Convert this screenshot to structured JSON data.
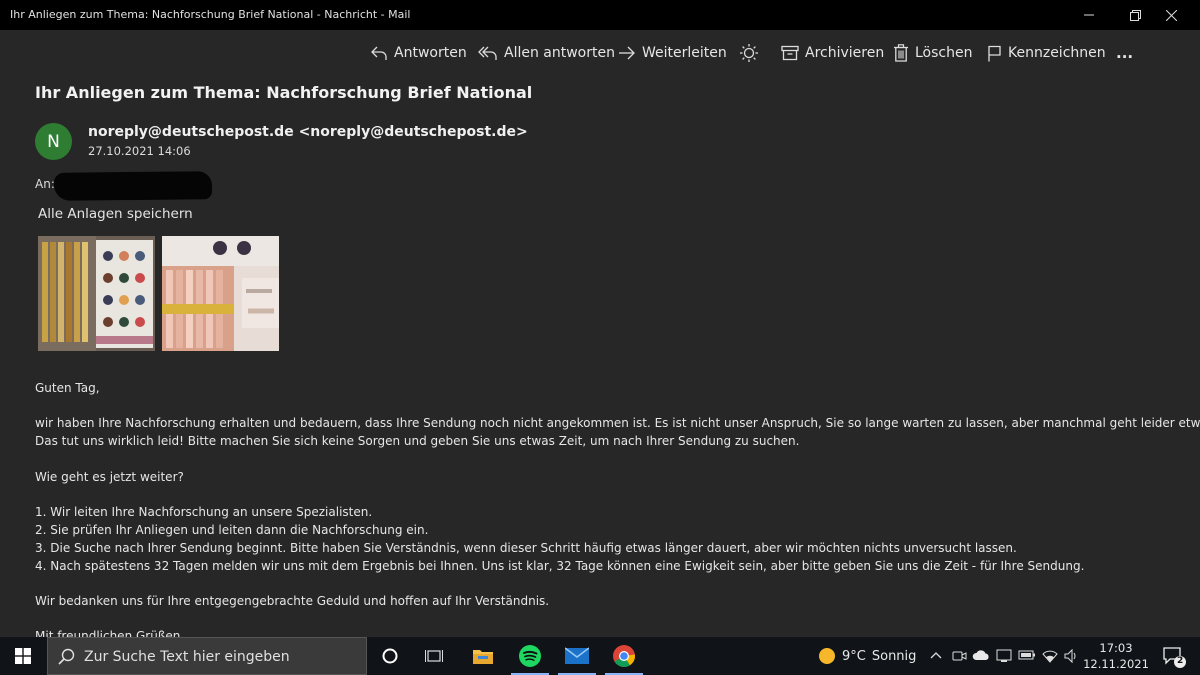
{
  "window": {
    "title": "Ihr Anliegen zum Thema: Nachforschung Brief National - Nachricht - Mail"
  },
  "toolbar": {
    "reply": "Antworten",
    "reply_all": "Allen antworten",
    "forward": "Weiterleiten",
    "archive": "Archivieren",
    "delete": "Löschen",
    "flag": "Kennzeichnen",
    "more": "..."
  },
  "message": {
    "subject": "Ihr Anliegen zum Thema: Nachforschung Brief National",
    "avatar_letter": "N",
    "sender": "noreply@deutschepost.de <noreply@deutschepost.de>",
    "date": "27.10.2021 14:06",
    "to_label": "An:",
    "save_all": "Alle Anlagen speichern",
    "attachment_count": 2,
    "body": {
      "greeting": "Guten Tag,",
      "p1_line1": "wir haben Ihre Nachforschung erhalten und bedauern, dass Ihre Sendung noch nicht angekommen ist. Es ist nicht unser Anspruch, Sie so lange warten zu lassen, aber manchmal geht leider etwas schief.",
      "p1_line2": "Das tut uns wirklich leid! Bitte machen Sie sich keine Sorgen und geben Sie uns etwas Zeit, um nach Ihrer Sendung zu suchen.",
      "question": "Wie geht es jetzt weiter?",
      "step1": "1. Wir leiten Ihre Nachforschung an unsere Spezialisten.",
      "step2": "2. Sie prüfen Ihr Anliegen und leiten dann die Nachforschung ein.",
      "step3": "3. Die Suche nach Ihrer Sendung beginnt. Bitte haben Sie Verständnis, wenn dieser Schritt häufig etwas länger dauert, aber wir möchten nichts unversucht lassen.",
      "step4": "4. Nach spätestens 32 Tagen melden wir uns mit dem Ergebnis bei Ihnen. Uns ist klar, 32 Tage können eine Ewigkeit sein, aber bitte geben Sie uns die Zeit - für Ihre Sendung.",
      "thanks": "Wir bedanken uns für Ihre entgegengebrachte Geduld und hoffen auf Ihr Verständnis.",
      "closing": "Mit freundlichen Grüßen"
    }
  },
  "taskbar": {
    "search_placeholder": "Zur Suche Text hier eingeben",
    "weather_temp": "9°C",
    "weather_text": "Sonnig",
    "time": "17:03",
    "date": "12.11.2021",
    "notification_count": "2",
    "apps": [
      "file-explorer",
      "spotify",
      "mail",
      "chrome"
    ]
  },
  "colors": {
    "background": "#272727",
    "titlebar": "#000000",
    "avatar": "#2e7d32",
    "taskbar": "#101318"
  }
}
